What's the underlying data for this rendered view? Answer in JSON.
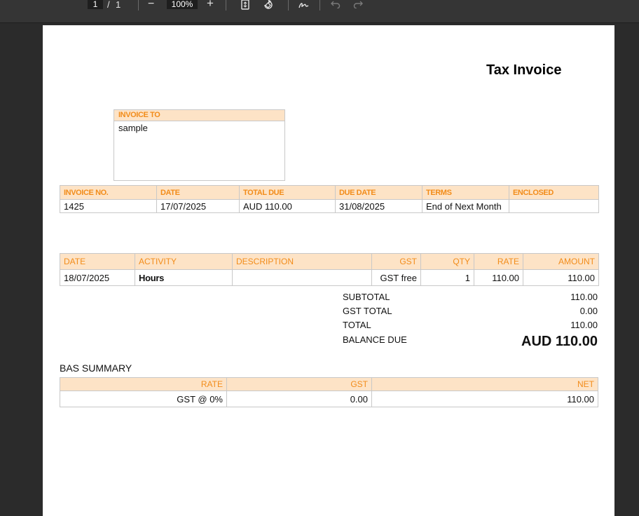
{
  "toolbar": {
    "page_current": "1",
    "page_separator": "/",
    "page_total": "1",
    "zoom_out": "−",
    "zoom_level": "100%",
    "zoom_in": "+"
  },
  "document": {
    "title": "Tax Invoice",
    "invoice_to": {
      "label": "INVOICE TO",
      "value": "sample"
    },
    "meta": {
      "headers": [
        "INVOICE NO.",
        "DATE",
        "TOTAL DUE",
        "DUE DATE",
        "TERMS",
        "ENCLOSED"
      ],
      "values": [
        "1425",
        "17/07/2025",
        "AUD 110.00",
        "31/08/2025",
        "End of Next Month",
        ""
      ]
    },
    "lines": {
      "headers": [
        "DATE",
        "ACTIVITY",
        "DESCRIPTION",
        "GST",
        "QTY",
        "RATE",
        "AMOUNT"
      ],
      "rows": [
        [
          "18/07/2025",
          "Hours",
          "",
          "GST free",
          "1",
          "110.00",
          "110.00"
        ]
      ]
    },
    "totals": {
      "subtotal_label": "SUBTOTAL",
      "subtotal": "110.00",
      "gst_label": "GST TOTAL",
      "gst": "0.00",
      "total_label": "TOTAL",
      "total": "110.00",
      "balance_label": "BALANCE DUE",
      "balance": "AUD 110.00"
    },
    "bas": {
      "title": "BAS SUMMARY",
      "headers": [
        "RATE",
        "GST",
        "NET"
      ],
      "rows": [
        [
          "GST @ 0%",
          "0.00",
          "110.00"
        ]
      ]
    }
  }
}
